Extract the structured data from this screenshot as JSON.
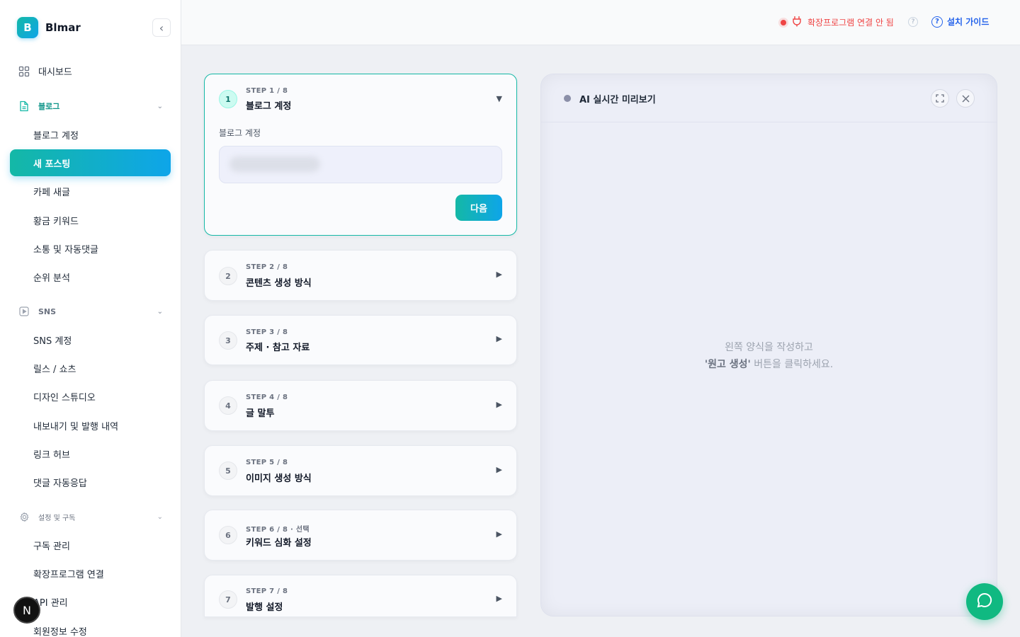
{
  "brand": {
    "logo_letter": "B",
    "name": "Blmar"
  },
  "sidebar": {
    "dashboard": "대시보드",
    "blog_section": "블로그",
    "blog_items": [
      "블로그 계정",
      "새 포스팅",
      "카페 새글",
      "황금 키워드",
      "소통 및 자동댓글",
      "순위 분석"
    ],
    "sns_section": "SNS",
    "sns_items": [
      "SNS 계정",
      "릴스 / 쇼츠",
      "디자인 스튜디오",
      "내보내기 및 발행 내역",
      "링크 허브",
      "댓글 자동응답"
    ],
    "settings_section": "설정 및 구독",
    "settings_items": [
      "구독 관리",
      "확장프로그램 연결",
      "API 관리",
      "회원정보 수정"
    ],
    "avatar_letter": "N"
  },
  "topbar": {
    "status_text": "확장프로그램 연결 안 됨",
    "guide_label": "설치 가이드",
    "status_color": "#ef4444",
    "accent_color": "#2563eb"
  },
  "steps": [
    {
      "num": "1",
      "label": "STEP 1 / 8",
      "title": "블로그 계정"
    },
    {
      "num": "2",
      "label": "STEP 2 / 8",
      "title": "콘텐츠 생성 방식"
    },
    {
      "num": "3",
      "label": "STEP 3 / 8",
      "title": "주제 · 참고 자료"
    },
    {
      "num": "4",
      "label": "STEP 4 / 8",
      "title": "글 말투"
    },
    {
      "num": "5",
      "label": "STEP 5 / 8",
      "title": "이미지 생성 방식"
    },
    {
      "num": "6",
      "label": "STEP 6 / 8 · 선택",
      "title": "키워드 심화 설정"
    },
    {
      "num": "7",
      "label": "STEP 7 / 8",
      "title": "발행 설정"
    }
  ],
  "step1_form": {
    "field_label": "블로그 계정",
    "next_label": "다음"
  },
  "preview": {
    "title": "AI 실시간 미리보기",
    "line1": "왼쪽 양식을 작성하고",
    "line2_bold": "'원고 생성'",
    "line2_rest": " 버튼을 클릭하세요."
  }
}
